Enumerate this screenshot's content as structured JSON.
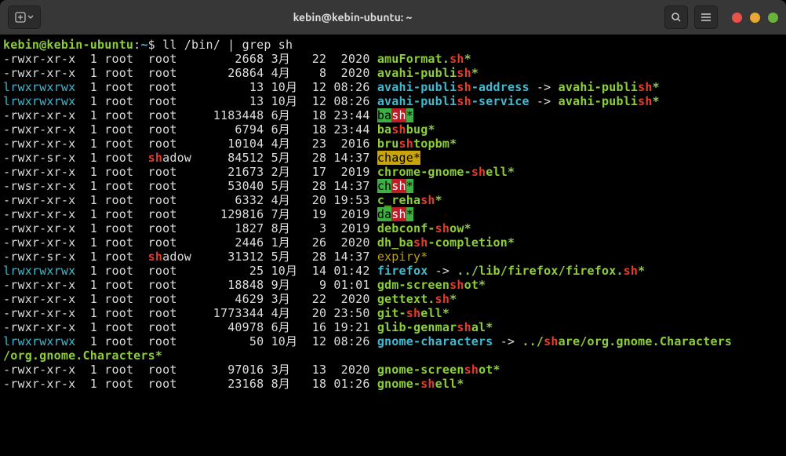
{
  "titlebar": {
    "title": "kebin@kebin-ubuntu: ~"
  },
  "prompt": {
    "user_host": "kebin@kebin-ubuntu",
    "colon": ":",
    "path": "~",
    "dollar": "$ ",
    "command": "ll /bin/ | grep sh"
  },
  "rows": [
    {
      "perm": "-rwxr-xr-x",
      "links": "1",
      "owner": "root",
      "group": "root",
      "size": "2668",
      "month": "3月",
      "day": "22",
      "time": "2020",
      "file_segments": [
        {
          "t": "amuFormat.",
          "c": "green-b"
        },
        {
          "t": "sh",
          "c": "red-b"
        },
        {
          "t": "*",
          "c": "green-b"
        }
      ]
    },
    {
      "perm": "-rwxr-xr-x",
      "links": "1",
      "owner": "root",
      "group": "root",
      "size": "26864",
      "month": "4月",
      "day": "8",
      "time": "2020",
      "file_segments": [
        {
          "t": "avahi-publi",
          "c": "green-b"
        },
        {
          "t": "sh",
          "c": "red-b"
        },
        {
          "t": "*",
          "c": "green-b"
        }
      ]
    },
    {
      "perm": "lrwxrwxrwx",
      "links": "1",
      "owner": "root",
      "group": "root",
      "size": "13",
      "month": "10月",
      "day": "12",
      "time": "08:26",
      "file_segments": [
        {
          "t": "avahi-publi",
          "c": "cyan-b"
        },
        {
          "t": "sh",
          "c": "red-b"
        },
        {
          "t": "-address",
          "c": "cyan-b"
        },
        {
          "t": " -> ",
          "c": "white"
        },
        {
          "t": "avahi-publi",
          "c": "green-b"
        },
        {
          "t": "sh",
          "c": "red-b"
        },
        {
          "t": "*",
          "c": "green-b"
        }
      ]
    },
    {
      "perm": "lrwxrwxrwx",
      "links": "1",
      "owner": "root",
      "group": "root",
      "size": "13",
      "month": "10月",
      "day": "12",
      "time": "08:26",
      "file_segments": [
        {
          "t": "avahi-publi",
          "c": "cyan-b"
        },
        {
          "t": "sh",
          "c": "red-b"
        },
        {
          "t": "-service",
          "c": "cyan-b"
        },
        {
          "t": " -> ",
          "c": "white"
        },
        {
          "t": "avahi-publi",
          "c": "green-b"
        },
        {
          "t": "sh",
          "c": "red-b"
        },
        {
          "t": "*",
          "c": "green-b"
        }
      ]
    },
    {
      "perm": "-rwxr-xr-x",
      "links": "1",
      "owner": "root",
      "group": "root",
      "size": "1183448",
      "month": "6月",
      "day": "18",
      "time": "23:44",
      "file_segments": [
        {
          "t": "ba",
          "c": "bg-green"
        },
        {
          "t": "sh",
          "c": "bg-red"
        },
        {
          "t": "*",
          "c": "bg-green"
        }
      ]
    },
    {
      "perm": "-rwxr-xr-x",
      "links": "1",
      "owner": "root",
      "group": "root",
      "size": "6794",
      "month": "6月",
      "day": "18",
      "time": "23:44",
      "file_segments": [
        {
          "t": "ba",
          "c": "green-b"
        },
        {
          "t": "sh",
          "c": "red-b"
        },
        {
          "t": "bug*",
          "c": "green-b"
        }
      ]
    },
    {
      "perm": "-rwxr-xr-x",
      "links": "1",
      "owner": "root",
      "group": "root",
      "size": "10104",
      "month": "4月",
      "day": "23",
      "time": "2016",
      "file_segments": [
        {
          "t": "bru",
          "c": "green-b"
        },
        {
          "t": "sh",
          "c": "red-b"
        },
        {
          "t": "topbm*",
          "c": "green-b"
        }
      ]
    },
    {
      "perm": "-rwxr-sr-x",
      "links": "1",
      "owner": "root",
      "group": "shadow",
      "group_hl": true,
      "size": "84512",
      "month": "5月",
      "day": "28",
      "time": "14:37",
      "file_segments": [
        {
          "t": "chage*",
          "c": "bg-yellow"
        }
      ]
    },
    {
      "perm": "-rwxr-xr-x",
      "links": "1",
      "owner": "root",
      "group": "root",
      "size": "21673",
      "month": "2月",
      "day": "17",
      "time": "2019",
      "file_segments": [
        {
          "t": "chrome-gnome-",
          "c": "green-b"
        },
        {
          "t": "sh",
          "c": "red-b"
        },
        {
          "t": "ell*",
          "c": "green-b"
        }
      ]
    },
    {
      "perm": "-rwsr-xr-x",
      "links": "1",
      "owner": "root",
      "group": "root",
      "size": "53040",
      "month": "5月",
      "day": "28",
      "time": "14:37",
      "file_segments": [
        {
          "t": "ch",
          "c": "bg-green"
        },
        {
          "t": "sh",
          "c": "bg-red"
        },
        {
          "t": "*",
          "c": "bg-green"
        }
      ]
    },
    {
      "perm": "-rwxr-xr-x",
      "links": "1",
      "owner": "root",
      "group": "root",
      "size": "6332",
      "month": "4月",
      "day": "20",
      "time": "19:53",
      "file_segments": [
        {
          "t": "c_reha",
          "c": "green-b"
        },
        {
          "t": "sh",
          "c": "red-b"
        },
        {
          "t": "*",
          "c": "green-b"
        }
      ]
    },
    {
      "perm": "-rwxr-xr-x",
      "links": "1",
      "owner": "root",
      "group": "root",
      "size": "129816",
      "month": "7月",
      "day": "19",
      "time": "2019",
      "file_segments": [
        {
          "t": "da",
          "c": "bg-green"
        },
        {
          "t": "sh",
          "c": "bg-red"
        },
        {
          "t": "*",
          "c": "bg-green"
        }
      ]
    },
    {
      "perm": "-rwxr-xr-x",
      "links": "1",
      "owner": "root",
      "group": "root",
      "size": "1827",
      "month": "8月",
      "day": "3",
      "time": "2019",
      "file_segments": [
        {
          "t": "debconf-",
          "c": "green-b"
        },
        {
          "t": "sh",
          "c": "red-b"
        },
        {
          "t": "ow*",
          "c": "green-b"
        }
      ]
    },
    {
      "perm": "-rwxr-xr-x",
      "links": "1",
      "owner": "root",
      "group": "root",
      "size": "2446",
      "month": "1月",
      "day": "26",
      "time": "2020",
      "file_segments": [
        {
          "t": "dh_ba",
          "c": "green-b"
        },
        {
          "t": "sh",
          "c": "red-b"
        },
        {
          "t": "-completion*",
          "c": "green-b"
        }
      ]
    },
    {
      "perm": "-rwxr-sr-x",
      "links": "1",
      "owner": "root",
      "group": "shadow",
      "group_hl": true,
      "size": "31312",
      "month": "5月",
      "day": "28",
      "time": "14:37",
      "file_segments": [
        {
          "t": "expiry*",
          "c": "yellow-bg-black"
        }
      ]
    },
    {
      "perm": "lrwxrwxrwx",
      "links": "1",
      "owner": "root",
      "group": "root",
      "size": "25",
      "month": "10月",
      "day": "14",
      "time": "01:42",
      "file_segments": [
        {
          "t": "firefox",
          "c": "cyan-b"
        },
        {
          "t": " -> ",
          "c": "white"
        },
        {
          "t": "../lib/firefox/firefox.",
          "c": "green-b"
        },
        {
          "t": "sh",
          "c": "red-b"
        },
        {
          "t": "*",
          "c": "green-b"
        }
      ]
    },
    {
      "perm": "-rwxr-xr-x",
      "links": "1",
      "owner": "root",
      "group": "root",
      "size": "18848",
      "month": "9月",
      "day": "9",
      "time": "01:01",
      "file_segments": [
        {
          "t": "gdm-screen",
          "c": "green-b"
        },
        {
          "t": "sh",
          "c": "red-b"
        },
        {
          "t": "ot*",
          "c": "green-b"
        }
      ]
    },
    {
      "perm": "-rwxr-xr-x",
      "links": "1",
      "owner": "root",
      "group": "root",
      "size": "4629",
      "month": "3月",
      "day": "22",
      "time": "2020",
      "file_segments": [
        {
          "t": "gettext.",
          "c": "green-b"
        },
        {
          "t": "sh",
          "c": "red-b"
        },
        {
          "t": "*",
          "c": "green-b"
        }
      ]
    },
    {
      "perm": "-rwxr-xr-x",
      "links": "1",
      "owner": "root",
      "group": "root",
      "size": "1773344",
      "month": "4月",
      "day": "20",
      "time": "23:50",
      "file_segments": [
        {
          "t": "git-",
          "c": "green-b"
        },
        {
          "t": "sh",
          "c": "red-b"
        },
        {
          "t": "ell*",
          "c": "green-b"
        }
      ]
    },
    {
      "perm": "-rwxr-xr-x",
      "links": "1",
      "owner": "root",
      "group": "root",
      "size": "40978",
      "month": "6月",
      "day": "16",
      "time": "19:21",
      "file_segments": [
        {
          "t": "glib-genmar",
          "c": "green-b"
        },
        {
          "t": "sh",
          "c": "red-b"
        },
        {
          "t": "al*",
          "c": "green-b"
        }
      ]
    },
    {
      "perm": "lrwxrwxrwx",
      "links": "1",
      "owner": "root",
      "group": "root",
      "size": "50",
      "month": "10月",
      "day": "12",
      "time": "08:26",
      "file_segments": [
        {
          "t": "gnome-characters",
          "c": "cyan-b"
        },
        {
          "t": " -> ",
          "c": "white"
        },
        {
          "t": "../",
          "c": "green-b"
        },
        {
          "t": "sh",
          "c": "red-b"
        },
        {
          "t": "are/org.gnome.Characters",
          "c": "green-b"
        }
      ],
      "wrap": [
        {
          "t": "/org.gnome.Characters*",
          "c": "green-b"
        }
      ]
    },
    {
      "perm": "-rwxr-xr-x",
      "links": "1",
      "owner": "root",
      "group": "root",
      "size": "97016",
      "month": "3月",
      "day": "13",
      "time": "2020",
      "file_segments": [
        {
          "t": "gnome-screen",
          "c": "green-b"
        },
        {
          "t": "sh",
          "c": "red-b"
        },
        {
          "t": "ot*",
          "c": "green-b"
        }
      ]
    },
    {
      "perm": "-rwxr-xr-x",
      "links": "1",
      "owner": "root",
      "group": "root",
      "size": "23168",
      "month": "8月",
      "day": "18",
      "time": "01:26",
      "file_segments": [
        {
          "t": "gnome-",
          "c": "green-b"
        },
        {
          "t": "sh",
          "c": "red-b"
        },
        {
          "t": "ell*",
          "c": "green-b"
        }
      ]
    }
  ]
}
